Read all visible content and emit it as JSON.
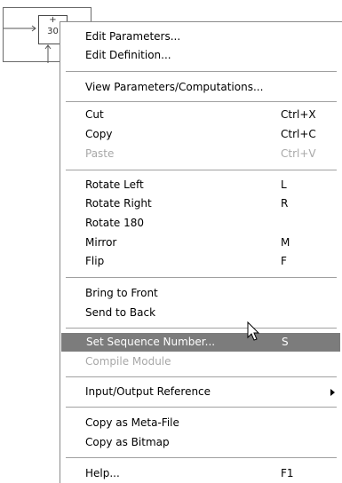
{
  "diagram": {
    "block_number": "30",
    "plus_sign": "+"
  },
  "menu": {
    "items": [
      {
        "label": "Edit Parameters...",
        "shortcut": ""
      },
      {
        "label": "Edit Definition...",
        "shortcut": ""
      },
      {
        "label": "View Parameters/Computations...",
        "shortcut": ""
      },
      {
        "label": "Cut",
        "shortcut": "Ctrl+X"
      },
      {
        "label": "Copy",
        "shortcut": "Ctrl+C"
      },
      {
        "label": "Paste",
        "shortcut": "Ctrl+V"
      },
      {
        "label": "Rotate Left",
        "shortcut": "L"
      },
      {
        "label": "Rotate Right",
        "shortcut": "R"
      },
      {
        "label": "Rotate 180",
        "shortcut": ""
      },
      {
        "label": "Mirror",
        "shortcut": "M"
      },
      {
        "label": "Flip",
        "shortcut": "F"
      },
      {
        "label": "Bring to Front",
        "shortcut": ""
      },
      {
        "label": "Send to Back",
        "shortcut": ""
      },
      {
        "label": "Set Sequence Number...",
        "shortcut": "S"
      },
      {
        "label": "Compile Module",
        "shortcut": ""
      },
      {
        "label": "Input/Output Reference",
        "shortcut": ""
      },
      {
        "label": "Copy as Meta-File",
        "shortcut": ""
      },
      {
        "label": "Copy as Bitmap",
        "shortcut": ""
      },
      {
        "label": "Help...",
        "shortcut": "F1"
      }
    ]
  },
  "colors": {
    "highlight": "#7c7c7c",
    "disabled_text": "#a8a8a8",
    "separator": "#a0a0a0"
  },
  "icons": {
    "submenu": "chevron-right-icon",
    "pointer": "mouse-pointer-icon"
  }
}
